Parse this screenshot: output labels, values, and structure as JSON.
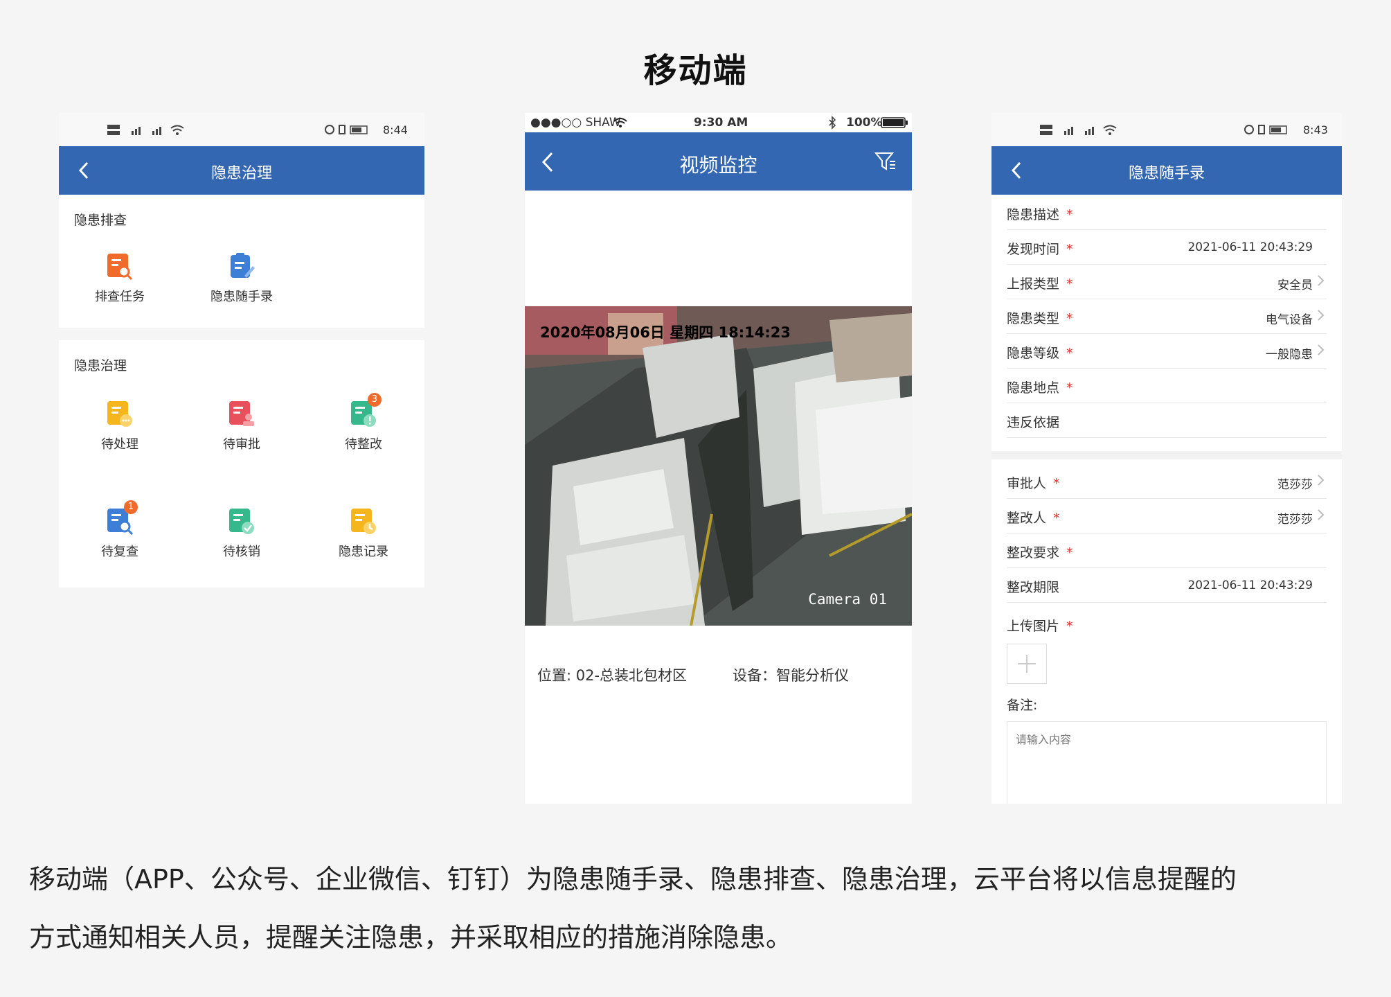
{
  "page_title": "移动端",
  "phone1": {
    "status_time": "8:44",
    "nav_title": "隐患治理",
    "section1_title": "隐患排查",
    "section1_items": [
      {
        "label": "排查任务",
        "icon": "search-doc-icon",
        "color": "#f06a2c"
      },
      {
        "label": "隐患随手录",
        "icon": "edit-doc-icon",
        "color": "#3d7fd6"
      }
    ],
    "section2_title": "隐患治理",
    "section2_items": [
      {
        "label": "待处理",
        "icon": "pending-doc-icon",
        "color": "#f5b51d",
        "badge": ""
      },
      {
        "label": "待审批",
        "icon": "approve-doc-icon",
        "color": "#e8505b",
        "badge": ""
      },
      {
        "label": "待整改",
        "icon": "rectify-doc-icon",
        "color": "#35b88c",
        "badge": "3"
      },
      {
        "label": "待复查",
        "icon": "recheck-doc-icon",
        "color": "#3d7fd6",
        "badge": "1"
      },
      {
        "label": "待核销",
        "icon": "verify-doc-icon",
        "color": "#35b88c",
        "badge": ""
      },
      {
        "label": "隐患记录",
        "icon": "record-doc-icon",
        "color": "#f5b51d",
        "badge": ""
      }
    ],
    "badge_color": "#f06a2c"
  },
  "phone2": {
    "status_carrier": "●●●○○ SHAW",
    "status_time": "9:30 AM",
    "status_battery": "100%",
    "nav_title": "视频监控",
    "video_timestamp": "2020年08月06日 星期四 18:14:23",
    "camera_label": "Camera 01",
    "location": "位置: 02-总装北包材区",
    "device": "设备：智能分析仪"
  },
  "phone3": {
    "status_time": "8:43",
    "nav_title": "隐患随手录",
    "fields": [
      {
        "label": "隐患描述",
        "required": "*",
        "value": "",
        "arrow": false
      },
      {
        "label": "发现时间",
        "required": "*",
        "value": "2021-06-11 20:43:29",
        "arrow": false
      },
      {
        "label": "上报类型",
        "required": "*",
        "value": "安全员",
        "arrow": true
      },
      {
        "label": "隐患类型",
        "required": "*",
        "value": "电气设备",
        "arrow": true
      },
      {
        "label": "隐患等级",
        "required": "*",
        "value": "一般隐患",
        "arrow": true
      },
      {
        "label": "隐患地点",
        "required": "*",
        "value": "",
        "arrow": false
      },
      {
        "label": "违反依据",
        "required": "",
        "value": "",
        "arrow": false
      }
    ],
    "fields2": [
      {
        "label": "审批人",
        "required": "*",
        "value": "范莎莎",
        "arrow": true
      },
      {
        "label": "整改人",
        "required": "*",
        "value": "范莎莎",
        "arrow": true
      },
      {
        "label": "整改要求",
        "required": "*",
        "value": "",
        "arrow": false
      },
      {
        "label": "整改期限",
        "required": "",
        "value": "2021-06-11 20:43:29",
        "arrow": false
      }
    ],
    "upload_label": "上传图片",
    "upload_required": "*",
    "remark_label": "备注:",
    "remark_placeholder": "请输入内容"
  },
  "description_line1": "移动端（APP、公众号、企业微信、钉钉）为隐患随手录、隐患排查、隐患治理，云平台将以信息提醒的",
  "description_line2": "方式通知相关人员，提醒关注隐患，并采取相应的措施消除隐患。",
  "colors": {
    "nav_blue": "#3367b2",
    "required_red": "#e0302b",
    "background": "#f5f5f5"
  }
}
